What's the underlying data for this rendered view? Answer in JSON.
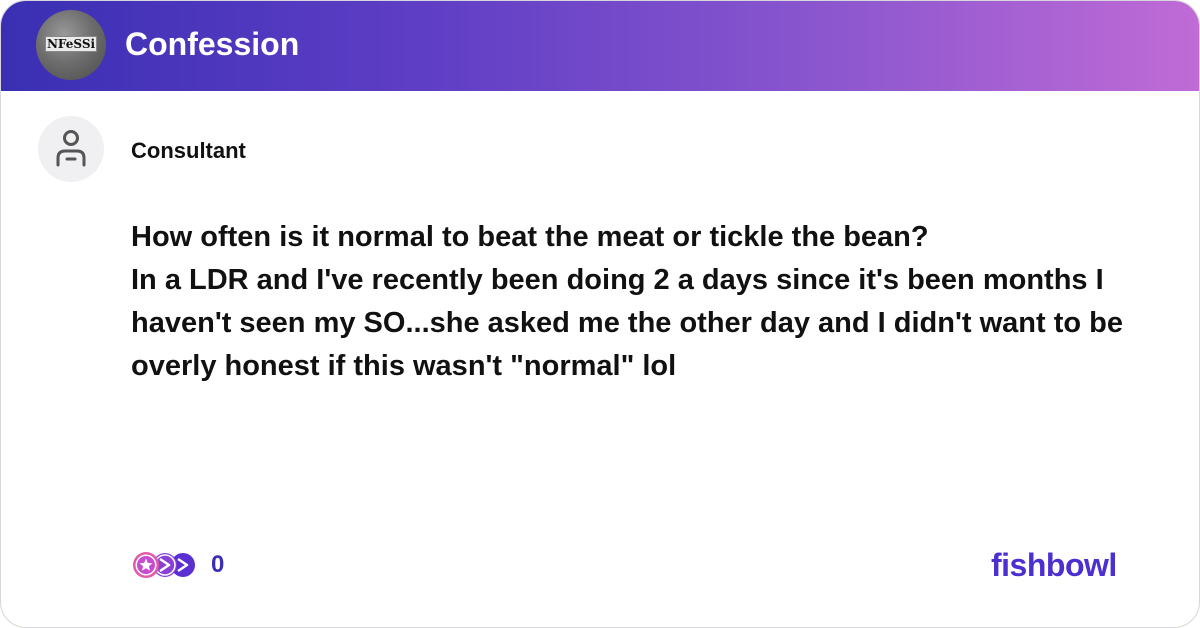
{
  "header": {
    "group_name": "Confession",
    "group_avatar_text": "NFeSSi"
  },
  "post": {
    "author": "Consultant",
    "lines": [
      "How often is it normal to beat the meat or tickle the bean?",
      "In a LDR and I've recently been doing 2 a days since it's been months I haven't seen my SO...she asked me the other day and I didn't want to be overly honest if this wasn't \"normal\" lol"
    ]
  },
  "footer": {
    "reaction_icons": [
      "heart-reaction-icon",
      "star-reaction-icon",
      "clap-reaction-icon"
    ],
    "reaction_count": "0",
    "brand": "fishbowl"
  },
  "colors": {
    "header_gradient_start": "#3a2fb3",
    "header_gradient_end": "#c06bd6",
    "brand": "#4b2fd1",
    "count": "#3a2fb3"
  }
}
